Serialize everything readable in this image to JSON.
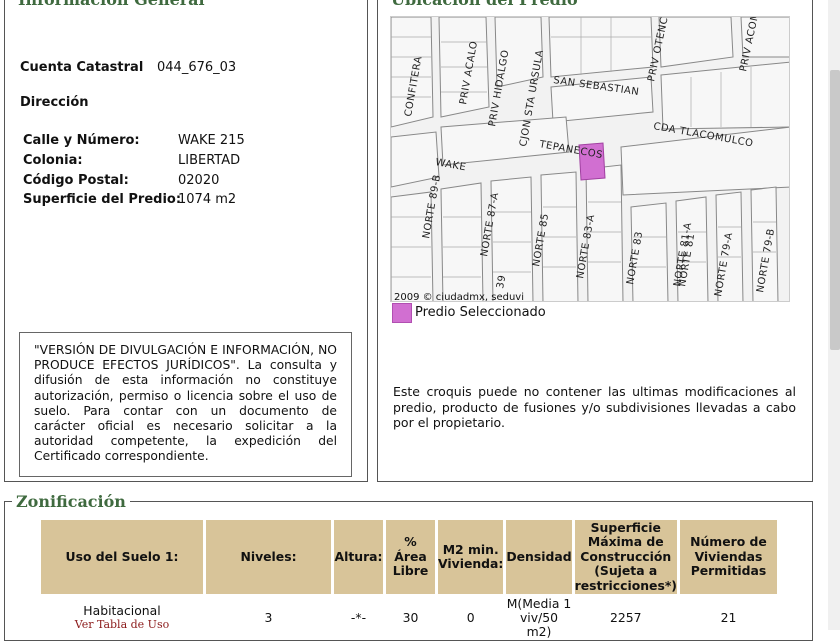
{
  "general": {
    "legend": "Información General",
    "cuenta_label": "Cuenta Catastral",
    "cuenta_value": "044_676_03",
    "direccion_label": "Dirección",
    "fields": [
      {
        "label": "Calle y Número:",
        "value": "WAKE 215"
      },
      {
        "label": "Colonia:",
        "value": "LIBERTAD"
      },
      {
        "label": "Código Postal:",
        "value": "02020"
      },
      {
        "label": "Superficie del Predio:",
        "value": "1074 m2"
      }
    ],
    "disclaimer": "\"VERSIÓN DE DIVULGACIÓN E INFORMACIÓN, NO PRODUCE EFECTOS JURÍDICOS\". La consulta y difusión de esta información no constituye autorización, permiso o licencia sobre el uso de suelo. Para contar con un documento de carácter oficial es necesario solicitar a la autoridad competente, la expedición del Certificado correspondiente."
  },
  "ubicacion": {
    "legend": "Ubicación del Predio",
    "copyright": "2009 © ciudadmx, seduvi",
    "legend_label": "Predio Seleccionado",
    "highlight_color": "#d16fd1",
    "streets": [
      "CONFITERA",
      "PRIV ACALO",
      "PRIV HIDALGO",
      "CJON STA URSULA",
      "SAN SEBASTIAN",
      "PRIV OTENCO",
      "PRIV ACOMUL",
      "CDA TLACOMULCO",
      "TEPANECOS",
      "WAKE",
      "NORTE 89-B",
      "NORTE 87-A",
      "NORTE 85",
      "NORTE 83-A",
      "NORTE 83",
      "NORTE 81-A",
      "NORTE 81",
      "NORTE 79-A",
      "NORTE 79-B",
      "39"
    ],
    "note": "Este croquis puede no contener las ultimas modificaciones al predio, producto de fusiones y/o subdivisiones llevadas a cabo por el propietario."
  },
  "zonificacion": {
    "legend": "Zonificación",
    "headers": [
      "Uso del Suelo 1:",
      "Niveles:",
      "Altura:",
      "% Área Libre",
      "M2 min. Vivienda:",
      "Densidad",
      "Superficie Máxima de Construcción (Sujeta a restricciones*)",
      "Número de Viviendas Permitidas"
    ],
    "row": {
      "uso": "Habitacional",
      "uso_link": "Ver Tabla de Uso",
      "niveles": "3",
      "altura": "-*-",
      "area_libre": "30",
      "m2_min": "0",
      "densidad": "M(Media 1 viv/50 m2)",
      "superficie": "2257",
      "viviendas": "21"
    }
  }
}
